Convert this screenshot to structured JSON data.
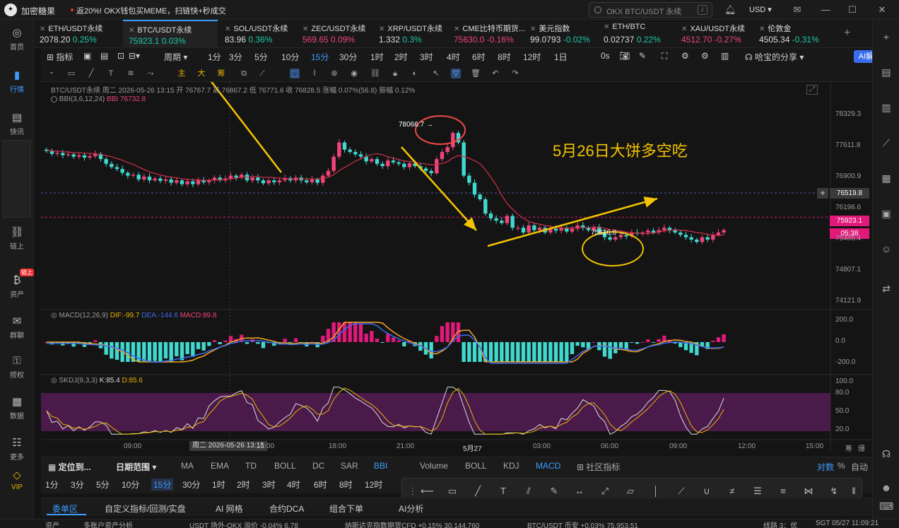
{
  "app": {
    "name": "加密糖果",
    "promo": "返20%! OKX钱包买MEME，扫链快+秒成交",
    "search_placeholder": "OKX BTC/USDT 永续",
    "search_kbd": "/",
    "currency": "USD"
  },
  "left_nav": [
    {
      "label": "首页",
      "icon": "home-icon"
    },
    {
      "label": "行情",
      "icon": "market-icon",
      "active": true
    },
    {
      "label": "快讯",
      "icon": "news-icon"
    },
    {
      "label": "链上",
      "icon": "onchain-icon"
    },
    {
      "label": "资产",
      "icon": "wallet-icon",
      "badge": "链上"
    },
    {
      "label": "群聊",
      "icon": "chat-icon"
    },
    {
      "label": "授权",
      "icon": "key-icon"
    },
    {
      "label": "数据",
      "icon": "data-icon"
    },
    {
      "label": "更多",
      "icon": "more-icon"
    },
    {
      "label": "VIP",
      "icon": "vip-icon"
    }
  ],
  "tickers": [
    {
      "name": "ETH/USDT永续",
      "price": "2078.20",
      "change": "0.25%",
      "dir": "up"
    },
    {
      "name": "BTC/USDT永续",
      "price": "75923.1",
      "change": "0.03%",
      "dir": "up",
      "active": true
    },
    {
      "name": "SOL/USDT永续",
      "price": "83.96",
      "change": "0.36%",
      "dir": "up"
    },
    {
      "name": "ZEC/USDT永续",
      "price": "569.65",
      "change": "0.09%",
      "dir": "dn"
    },
    {
      "name": "XRP/USDT永续",
      "price": "1.332",
      "change": "0.3%",
      "dir": "up"
    },
    {
      "name": "CME比特币期货...",
      "price": "75630.0",
      "change": "-0.16%",
      "dir": "dn"
    },
    {
      "name": "美元指数",
      "price": "99.0793",
      "change": "-0.02%",
      "dir": "up"
    },
    {
      "name": "ETH/BTC",
      "price": "0.02737",
      "change": "0.22%",
      "dir": "up"
    },
    {
      "name": "XAU/USDT永续",
      "price": "4512.70",
      "change": "-0.27%",
      "dir": "dn"
    },
    {
      "name": "伦敦金",
      "price": "4505.34",
      "change": "-0.31%",
      "dir": "up"
    }
  ],
  "toolbar": {
    "indicator": "指标",
    "period": "周期",
    "intervals": [
      "1分",
      "3分",
      "5分",
      "10分",
      "15分",
      "30分",
      "1时",
      "2时",
      "3时",
      "4时",
      "6时",
      "8时",
      "12时",
      "1日"
    ],
    "active_interval": "15分",
    "timer": "0s",
    "share": "哈宝的分享",
    "ai": "AI解读"
  },
  "draw_bar": [
    "主",
    "大",
    "筹"
  ],
  "chart_info": {
    "symbol_line": "BTC/USDT永续  周二 2026-05-26 13:15  开 76767.7  高 76867.2  低 76771.6  收 76828.5  涨幅 0.07%(56.8)  振幅 0.12%",
    "bbi_name": "BBI(3,6,12,24)",
    "bbi_value": "BBI 76732.8",
    "macd_name": "MACD(12,26,9)",
    "dif": "DIF:-99.7",
    "dea": "DEA:-144.6",
    "macd": "MACD:89.8",
    "skdj_name": "SKDJ(9,3,3)",
    "k": "K:85.4",
    "d": "D:85.6",
    "annotation": "5月26日大饼多空吃",
    "high_label": "78066.7",
    "low_label": "75626.0",
    "hover_time": "周二 2026-05-26 13:15",
    "current_price": "75923.1",
    "countdown": "05:38",
    "crosshair_price": "76519.8"
  },
  "y_axis": [
    "78329.3",
    "77611.8",
    "76900.9",
    "76196.6",
    "75485.4",
    "74807.1",
    "74121.9"
  ],
  "macd_axis": [
    "200.0",
    "0.0",
    "-200.0"
  ],
  "skdj_axis": [
    "100.0",
    "80.0",
    "50.0",
    "20.0",
    "0.0"
  ],
  "x_axis": [
    "09:00",
    "15:00",
    "18:00",
    "21:00",
    "5月27",
    "03:00",
    "06:00",
    "09:00",
    "12:00",
    "15:00"
  ],
  "axis_corner": [
    "筹",
    "爆"
  ],
  "indicator_bar": {
    "locate": "定位到...",
    "range": "日期范围",
    "main": [
      "MA",
      "EMA",
      "TD",
      "BOLL",
      "DC",
      "SAR",
      "BBI"
    ],
    "active_main": "BBI",
    "sub": [
      "Volume",
      "BOLL",
      "KDJ",
      "MACD"
    ],
    "active_sub": "MACD",
    "community": "社区指标",
    "log": "对数",
    "percent": "%",
    "auto": "自动"
  },
  "timeframes": [
    "1分",
    "3分",
    "5分",
    "10分",
    "15分",
    "30分",
    "1时",
    "2时",
    "3时",
    "4时",
    "6时",
    "8时",
    "12时",
    "1日"
  ],
  "bottom_tabs": [
    "委单区",
    "自定义指标/回测/实盘",
    "AI 网格",
    "合约DCA",
    "组合下单",
    "AI分析"
  ],
  "status": [
    "资产",
    "多账户资产分析",
    "USDT 场外-OKX  溢价 -0.04%  6.78",
    "纳斯达克指数期货CFD  +0.15%  30,144.760",
    "BTC/USDT 币安  +0.03%  75,953.51",
    "线路 3：优",
    "SGT 05/27 11:09:21"
  ],
  "chart_data": {
    "type": "candlestick",
    "symbol": "BTC/USDT永续",
    "interval": "15分",
    "y_range": [
      74121.9,
      78329.3
    ],
    "macd_range": [
      -200,
      200
    ],
    "skdj_range": [
      0,
      100
    ],
    "annotation_marks": {
      "high": 78066.7,
      "low": 75626.0
    },
    "closes": [
      77320,
      77260,
      77280,
      77230,
      77250,
      77200,
      77230,
      77180,
      77210,
      77260,
      77150,
      77050,
      76980,
      76940,
      76860,
      76800,
      76820,
      76720,
      76780,
      76700,
      76740,
      76690,
      76720,
      76650,
      76700,
      76620,
      76680,
      76620,
      76700,
      76660,
      76700,
      76760,
      76700,
      76740,
      76800,
      76760,
      76820,
      76700,
      76760,
      76700,
      76640,
      76700,
      76660,
      76700,
      76750,
      76700,
      76760,
      76700,
      76660,
      76720,
      76650,
      76800,
      76900,
      77200,
      77500,
      77350,
      77300,
      77250,
      77200,
      77100,
      77150,
      77050,
      77000,
      77120,
      77080,
      77050,
      76980,
      77060,
      77000,
      76950,
      76900,
      76850,
      77150,
      77300,
      77400,
      77700,
      77500,
      76800,
      76650,
      76400,
      76300,
      76000,
      75900,
      75850,
      75800,
      75950,
      75700,
      75700,
      75600,
      75750,
      75650,
      75700,
      75600,
      75680,
      75640,
      75700,
      75620,
      75680,
      75750,
      75700,
      75650,
      75720,
      75600,
      75500,
      75450,
      75500,
      75550,
      75520,
      75600,
      75580,
      75600,
      75640,
      75600,
      75650,
      75700,
      75650,
      75600,
      75550,
      75500,
      75450,
      75400,
      75500,
      75450,
      75550,
      75600,
      75650
    ]
  }
}
